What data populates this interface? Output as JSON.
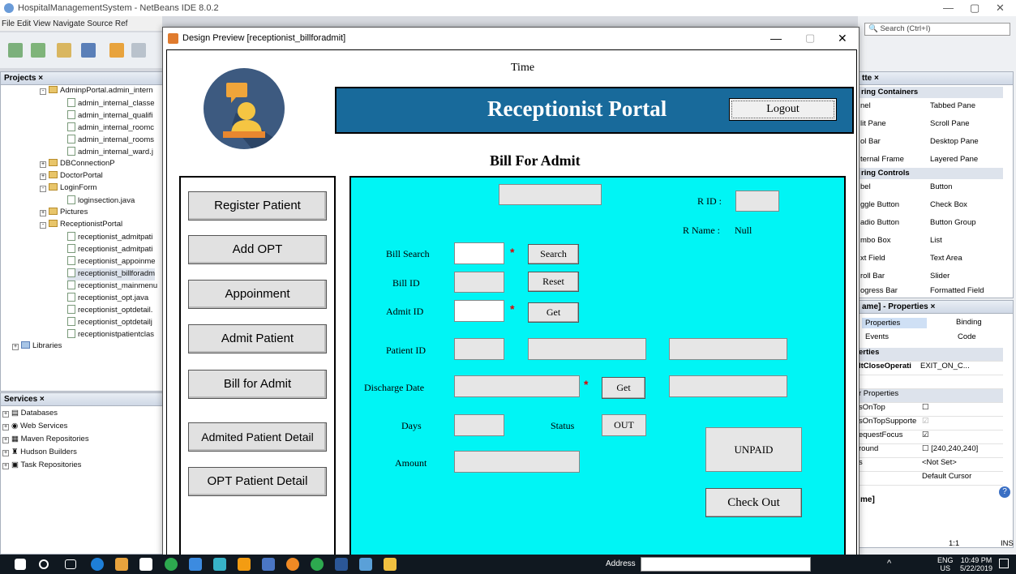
{
  "ide": {
    "title": "HospitalManagementSystem - NetBeans IDE 8.0.2",
    "menu": "File  Edit  View  Navigate  Source  Ref",
    "search_placeholder": "Search (Ctrl+I)",
    "projects": {
      "header": "Projects ×",
      "items": [
        "AdminpPortal.admin_intern",
        "admin_internal_classe",
        "admin_internal_qualifi",
        "admin_internal_roomc",
        "admin_internal_rooms",
        "admin_internal_ward.j",
        "DBConnectionP",
        "DoctorPortal",
        "LoginForm",
        "loginsection.java",
        "Pictures",
        "ReceptionistPortal",
        "receptionist_admitpati",
        "receptionist_admitpati",
        "receptionist_appoinme",
        "receptionist_billforadm",
        "receptionist_mainmenu",
        "receptionist_opt.java",
        "receptionist_optdetail.",
        "receptionist_optdetailj",
        "receptionistpatientclas",
        "Libraries"
      ]
    },
    "services": {
      "header": "Services ×",
      "items": [
        "Databases",
        "Web Services",
        "Maven Repositories",
        "Hudson Builders",
        "Task Repositories"
      ]
    },
    "palette": {
      "header": "tte ×",
      "cat1": "ring Containers",
      "containers": [
        [
          "nel",
          "Tabbed Pane"
        ],
        [
          "lit Pane",
          "Scroll Pane"
        ],
        [
          "ol Bar",
          "Desktop Pane"
        ],
        [
          "ternal Frame",
          "Layered Pane"
        ]
      ],
      "cat2": "ring Controls",
      "controls": [
        [
          "bel",
          "Button"
        ],
        [
          "ggle Button",
          "Check Box"
        ],
        [
          "adio Button",
          "Button Group"
        ],
        [
          "mbo Box",
          "List"
        ],
        [
          "xt Field",
          "Text Area"
        ],
        [
          "roll Bar",
          "Slider"
        ],
        [
          "ogress Bar",
          "Formatted Field"
        ]
      ]
    },
    "properties": {
      "header": "ame] - Properties ×",
      "tab_properties": "Properties",
      "tab_binding": "Binding",
      "tab_events": "Events",
      "tab_code": "Code",
      "section1": "erties",
      "row1_name": "ltCloseOperati",
      "row1_value": "EXIT_ON_C...",
      "section2": "r Properties",
      "rows": [
        [
          "sOnTop",
          ""
        ],
        [
          "sOnTopSupporte",
          ""
        ],
        [
          "equestFocus",
          ""
        ],
        [
          "round",
          "[240,240,240]"
        ],
        [
          "s",
          "<Not Set>"
        ],
        [
          "",
          "Default Cursor"
        ]
      ],
      "footer": "me]"
    },
    "status": {
      "position": "1:1",
      "mode": "INS"
    }
  },
  "preview": {
    "window_title": "Design Preview [receptionist_billforadmit]",
    "time_label": "Time",
    "banner_title": "Receptionist Portal",
    "logout_label": "Logout",
    "page_heading": "Bill For Admit",
    "sidebar": [
      "Register Patient",
      "Add OPT",
      "Appoinment",
      "Admit Patient",
      "Bill for Admit",
      "Admited Patient Detail",
      "OPT Patient Detail"
    ],
    "form": {
      "rid_label": "R ID :",
      "rname_label": "R Name :",
      "rname_value": "Null",
      "bill_search_label": "Bill Search",
      "search_button": "Search",
      "bill_id_label": "Bill ID",
      "reset_button": "Reset",
      "admit_id_label": "Admit ID",
      "get_button": "Get",
      "patient_id_label": "Patient ID",
      "discharge_date_label": "Discharge Date",
      "discharge_get_button": "Get",
      "days_label": "Days",
      "status_label": "Status",
      "status_value": "OUT",
      "amount_label": "Amount",
      "payment_status": "UNPAID",
      "checkout_button": "Check Out",
      "required_mark": "*"
    }
  },
  "taskbar": {
    "address_label": "Address",
    "lang": "ENG",
    "lang_sub": "US",
    "time": "10:49 PM",
    "date": "5/22/2019"
  }
}
